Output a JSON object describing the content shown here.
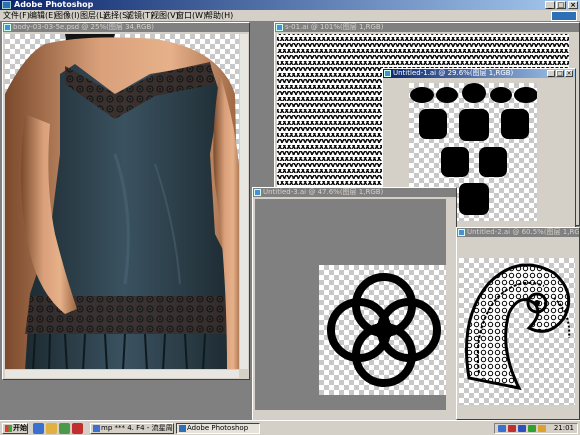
{
  "app": {
    "title": "Adobe Photoshop"
  },
  "menu": [
    "文件(F)",
    "编辑(E)",
    "图像(I)",
    "图层(L)",
    "选择(S)",
    "滤镜(T)",
    "视图(V)",
    "窗口(W)",
    "帮助(H)"
  ],
  "windows": {
    "body": {
      "title": "body-03-03-5e.psd @ 25%(图层 34,RGB)"
    },
    "pattern": {
      "title": "s-01.ai @ 101%(图层 1,RGB)"
    },
    "untitled1": {
      "title": "Untitled-1.ai @ 29.6%(图层 1,RGB)"
    },
    "untitled3": {
      "title": "Untitled-3.ai @ 47.6%(图层 1,RGB)"
    },
    "untitled2": {
      "title": "Untitled-2.ai @ 60.5%(图层 1,RGB)"
    }
  },
  "taskbar": {
    "start": "开始",
    "tasks": [
      "mp *** 4. F4 - 流星周 -",
      "Adobe Photoshop"
    ],
    "clock": "21:01"
  },
  "icons": {
    "app": "photoshop-icon",
    "start": "windows-flag-icon"
  },
  "colors": {
    "titlebar_active": "#0a246a",
    "workspace": "#808080",
    "chrome": "#d4d0c8",
    "dress": "#2b3e47"
  }
}
